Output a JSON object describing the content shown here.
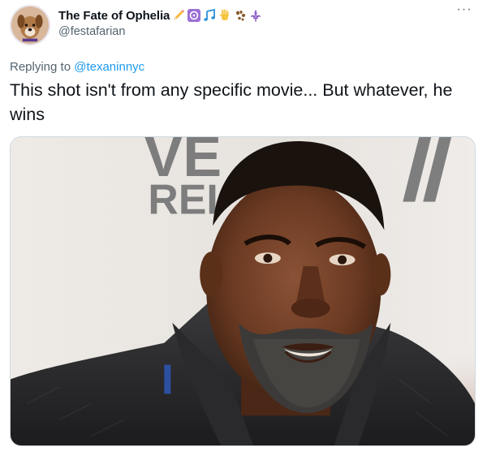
{
  "author": {
    "display_name": "The Fate of Ophelia",
    "handle": "@festafarian",
    "avatar_icon": "dog-avatar",
    "name_emojis": [
      "pencil-icon",
      "om-symbol-icon",
      "music-notes-icon",
      "raised-hand-icon",
      "paw-prints-icon",
      "fleur-de-lis-icon"
    ]
  },
  "more_label": "···",
  "reply": {
    "prefix": "Replying to ",
    "mention": "@texaninnyc"
  },
  "tweet_text": "This shot isn't from any specific movie... But whatever, he wins",
  "media": {
    "backdrop_text": "VE REI",
    "description_icon": "photo-portrait"
  },
  "colors": {
    "link": "#1d9bf0",
    "secondary_text": "#536471",
    "primary_text": "#0f1419",
    "border": "#cfd9de"
  }
}
